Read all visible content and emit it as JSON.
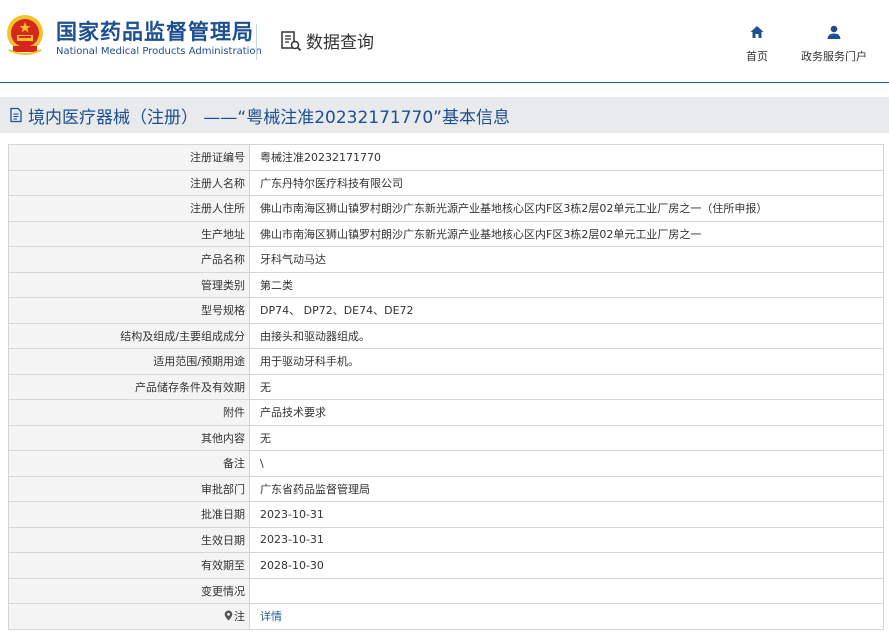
{
  "header": {
    "brand_cn": "国家药品监督管理局",
    "brand_en": "National Medical Products Administration",
    "query_label": "数据查询",
    "nav": [
      {
        "label": "首页",
        "icon": "home-icon"
      },
      {
        "label": "政务服务门户",
        "icon": "user-icon"
      }
    ],
    "colors": {
      "brand": "#1d4f91",
      "accent": "#1d5fa8",
      "emblem_red": "#d7261e",
      "emblem_gold": "#f3c228"
    }
  },
  "page": {
    "title": "境内医疗器械（注册） ——“粤械注准20232171770”基本信息"
  },
  "rows": [
    {
      "label": "注册证编号",
      "value": "粤械注准20232171770"
    },
    {
      "label": "注册人名称",
      "value": "广东丹特尔医疗科技有限公司"
    },
    {
      "label": "注册人住所",
      "value": "佛山市南海区狮山镇罗村朗沙广东新光源产业基地核心区内F区3栋2层02单元工业厂房之一（住所申报）"
    },
    {
      "label": "生产地址",
      "value": "佛山市南海区狮山镇罗村朗沙广东新光源产业基地核心区内F区3栋2层02单元工业厂房之一"
    },
    {
      "label": "产品名称",
      "value": "牙科气动马达"
    },
    {
      "label": "管理类别",
      "value": "第二类"
    },
    {
      "label": "型号规格",
      "value": "DP74、 DP72、DE74、DE72"
    },
    {
      "label": "结构及组成/主要组成成分",
      "value": "由接头和驱动器组成。"
    },
    {
      "label": "适用范围/预期用途",
      "value": "用于驱动牙科手机。"
    },
    {
      "label": "产品储存条件及有效期",
      "value": "无"
    },
    {
      "label": "附件",
      "value": "产品技术要求"
    },
    {
      "label": "其他内容",
      "value": "无"
    },
    {
      "label": "备注",
      "value": "\\"
    },
    {
      "label": "审批部门",
      "value": "广东省药品监督管理局"
    },
    {
      "label": "批准日期",
      "value": "2023-10-31"
    },
    {
      "label": "生效日期",
      "value": "2023-10-31"
    },
    {
      "label": "有效期至",
      "value": "2028-10-30"
    },
    {
      "label": "变更情况",
      "value": ""
    },
    {
      "label": "注",
      "value": "详情",
      "label_icon": "pin-icon"
    }
  ]
}
